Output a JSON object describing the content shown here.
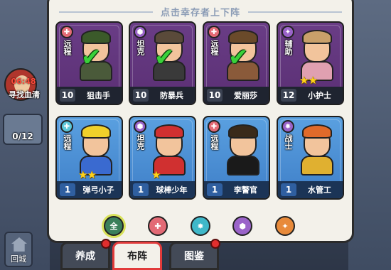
{
  "panel": {
    "title": "点击幸存者上下阵"
  },
  "side": {
    "timer": "06:48",
    "event_label": "寻找血清",
    "count": "0/12",
    "home_label": "回城"
  },
  "cards": [
    {
      "role": "远程",
      "level": "10",
      "name": "狙击手",
      "frame": "purple",
      "role_icon": "ranged-icon",
      "deployed": true,
      "stars": 0
    },
    {
      "role": "坦克",
      "level": "10",
      "name": "防暴兵",
      "frame": "purple",
      "role_icon": "tank-icon",
      "deployed": true,
      "stars": 0
    },
    {
      "role": "远程",
      "level": "10",
      "name": "爱丽莎",
      "frame": "purple",
      "role_icon": "ranged-icon",
      "deployed": true,
      "stars": 0
    },
    {
      "role": "辅助",
      "level": "12",
      "name": "小护士",
      "frame": "purple",
      "role_icon": "support-icon",
      "deployed": false,
      "stars": 2
    },
    {
      "role": "远程",
      "level": "1",
      "name": "弹弓小子",
      "frame": "blue",
      "role_icon": "ranged-icon",
      "deployed": false,
      "stars": 2
    },
    {
      "role": "坦克",
      "level": "1",
      "name": "球棒少年",
      "frame": "blue",
      "role_icon": "tank-icon",
      "deployed": false,
      "stars": 1
    },
    {
      "role": "远程",
      "level": "1",
      "name": "李警官",
      "frame": "blue",
      "role_icon": "ranged-icon",
      "deployed": false,
      "stars": 0
    },
    {
      "role": "战士",
      "level": "1",
      "name": "水管工",
      "frame": "blue",
      "role_icon": "fighter-icon",
      "deployed": false,
      "stars": 0
    }
  ],
  "filters": [
    {
      "label": "全",
      "icon": "all-icon",
      "color": "#3a7f5a",
      "active": true
    },
    {
      "label": "",
      "icon": "ranged-filter-icon",
      "color": "#e36a75",
      "active": false
    },
    {
      "label": "",
      "icon": "fighter-filter-icon",
      "color": "#3fb8c9",
      "active": false
    },
    {
      "label": "",
      "icon": "tank-filter-icon",
      "color": "#9a63c9",
      "active": false
    },
    {
      "label": "",
      "icon": "support-filter-icon",
      "color": "#e88a3a",
      "active": false
    }
  ],
  "tabs": [
    {
      "label": "养成",
      "active": false,
      "red_dot": true
    },
    {
      "label": "布阵",
      "active": true,
      "red_dot": false
    },
    {
      "label": "图鉴",
      "active": false,
      "red_dot": true
    }
  ],
  "colors": {
    "purple_frame": "#6a3d86",
    "blue_frame": "#4a8fd6",
    "check": "#3ad13a",
    "star": "#ffd21a",
    "active_tab_border": "#e23b3b"
  }
}
